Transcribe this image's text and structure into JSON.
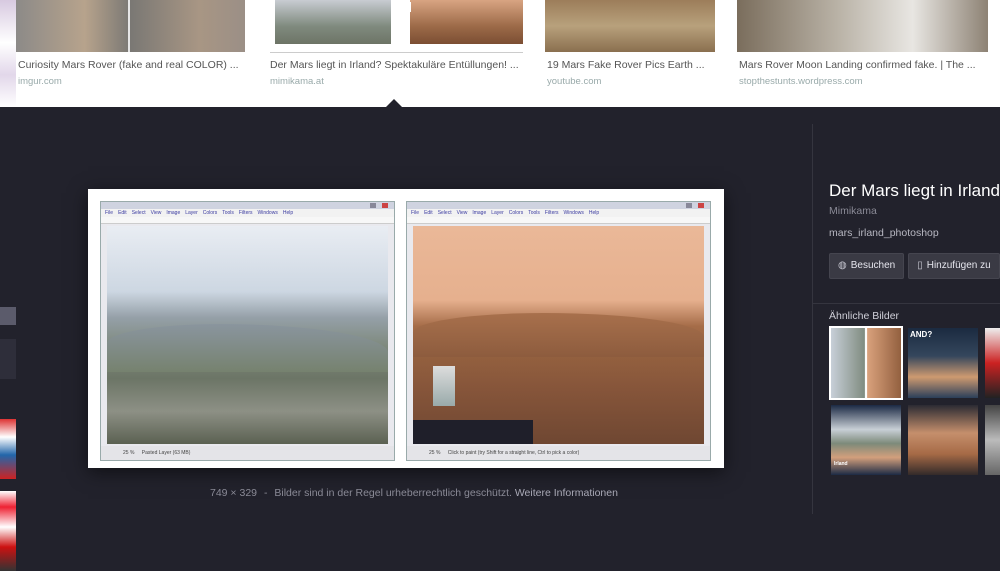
{
  "results": [
    {
      "title": "Curiosity Mars Rover (fake and real COLOR) ...",
      "domain": "imgur.com"
    },
    {
      "title": "Der Mars liegt in Irland? Spektakuläre Entüllungen! ...",
      "domain": "mimikama.at"
    },
    {
      "title": "19 Mars Fake Rover Pics Earth ...",
      "domain": "youtube.com"
    },
    {
      "title": "Mars Rover Moon Landing confirmed fake. | The ...",
      "domain": "stopthestunts.wordpress.com"
    }
  ],
  "preview": {
    "dimensions": "749 × 329",
    "copyright_text": "Bilder sind in der Regel urheberrechtlich geschützt.",
    "more_info_link": "Weitere Informationen",
    "left_window": {
      "menu": [
        "File",
        "Edit",
        "Select",
        "View",
        "Image",
        "Layer",
        "Colors",
        "Tools",
        "Filters",
        "Windows",
        "Help"
      ],
      "status": "Pasted Layer (63 MB)",
      "zoom": "25 %"
    },
    "right_window": {
      "menu": [
        "File",
        "Edit",
        "Select",
        "View",
        "Image",
        "Layer",
        "Colors",
        "Tools",
        "Filters",
        "Windows",
        "Help"
      ],
      "status": "Click to paint (try Shift for a straight line, Ctrl to pick a color)",
      "zoom": "25 %"
    }
  },
  "info": {
    "title": "Der Mars liegt in Irland",
    "source": "Mimikama",
    "filename": "mars_irland_photoshop",
    "visit_button": "Besuchen",
    "save_button": "Hinzufügen zu"
  },
  "similar": {
    "label": "Ähnliche Bilder",
    "items": [
      {
        "caption": ""
      },
      {
        "caption": "AND?"
      },
      {
        "caption": ""
      },
      {
        "caption": "Irland"
      },
      {
        "caption": ""
      }
    ]
  },
  "colors": {
    "background": "#22222c",
    "strip_background": "#ffffff",
    "mars_sky": "#e8b08c",
    "earth_sky": "#e2e8f0"
  }
}
